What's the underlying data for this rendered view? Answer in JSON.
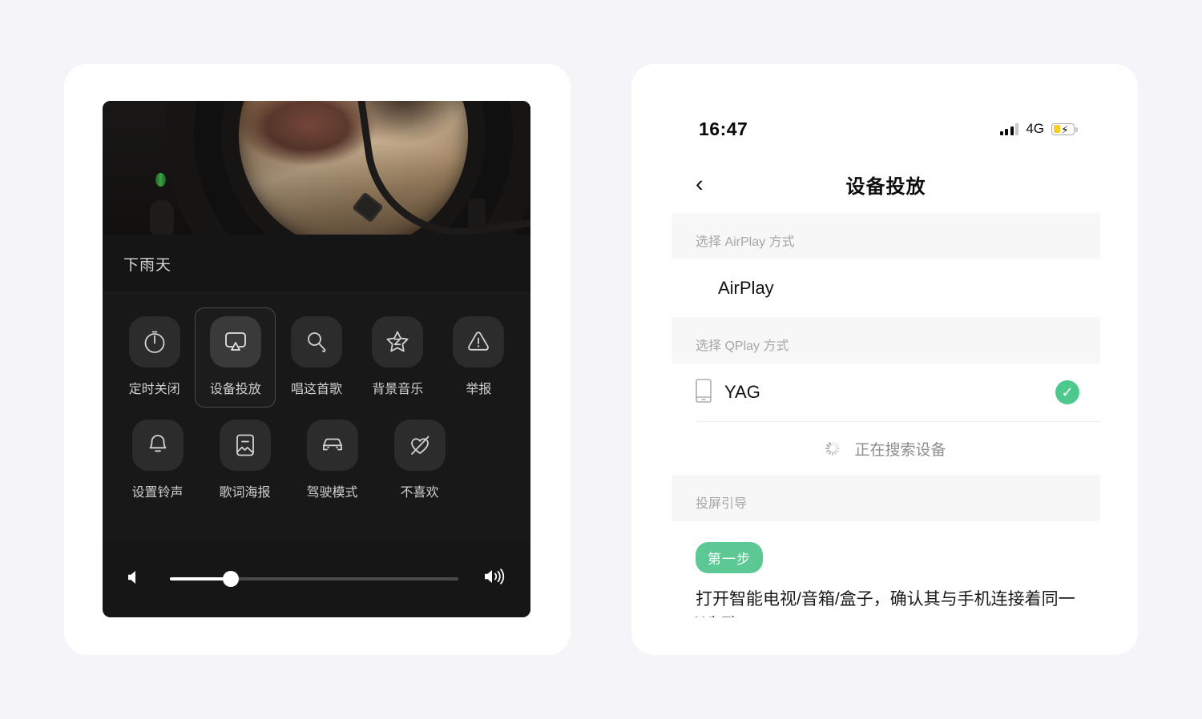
{
  "page": {
    "background_color": "#f5f4f9",
    "card_color": "#ffffff"
  },
  "player_sheet": {
    "song_title": "下雨天",
    "artwork": {
      "description": "dark turntable with circular window showing warm-toned photo",
      "led_color": "#3da345"
    },
    "actions_row1": [
      {
        "label": "定时关闭",
        "icon": "timer-icon",
        "selected": false
      },
      {
        "label": "设备投放",
        "icon": "cast-device-icon",
        "selected": true
      },
      {
        "label": "唱这首歌",
        "icon": "microphone-icon",
        "selected": false
      },
      {
        "label": "背景音乐",
        "icon": "star-z-icon",
        "selected": false
      },
      {
        "label": "举报",
        "icon": "warning-icon",
        "selected": false
      }
    ],
    "actions_row2": [
      {
        "label": "设置铃声",
        "icon": "bell-icon",
        "selected": false
      },
      {
        "label": "歌词海报",
        "icon": "image-poster-icon",
        "selected": false
      },
      {
        "label": "驾驶模式",
        "icon": "car-icon",
        "selected": false
      },
      {
        "label": "不喜欢",
        "icon": "heart-crossed-icon",
        "selected": false
      }
    ],
    "volume": {
      "value_percent": 21,
      "min_icon": "volume-low-icon",
      "max_icon": "volume-high-icon"
    }
  },
  "cast_settings": {
    "status_bar": {
      "time": "16:47",
      "network": "4G",
      "signal_icon": "signal-bars-icon",
      "battery_icon": "battery-charging-icon",
      "battery_percent": 35,
      "battery_color": "#ffcc23"
    },
    "nav": {
      "back_icon": "chevron-left-icon",
      "title": "设备投放"
    },
    "airplay_section": {
      "header": "选择 AirPlay 方式",
      "items": [
        {
          "label": "AirPlay"
        }
      ]
    },
    "qplay_section": {
      "header": "选择 QPlay 方式",
      "items": [
        {
          "label": "YAG",
          "device_icon": "phone-device-icon",
          "selected": true,
          "check_icon": "check-circle-icon",
          "check_color": "#4ec98e"
        }
      ],
      "searching": {
        "text": "正在搜索设备",
        "icon": "loading-spinner-icon"
      }
    },
    "guide_section": {
      "header": "投屏引导",
      "step_badge": "第一步",
      "badge_color": "#5cc894",
      "text": "打开智能电视/音箱/盒子，确认其与手机连接着同一Wi-Fi"
    }
  }
}
